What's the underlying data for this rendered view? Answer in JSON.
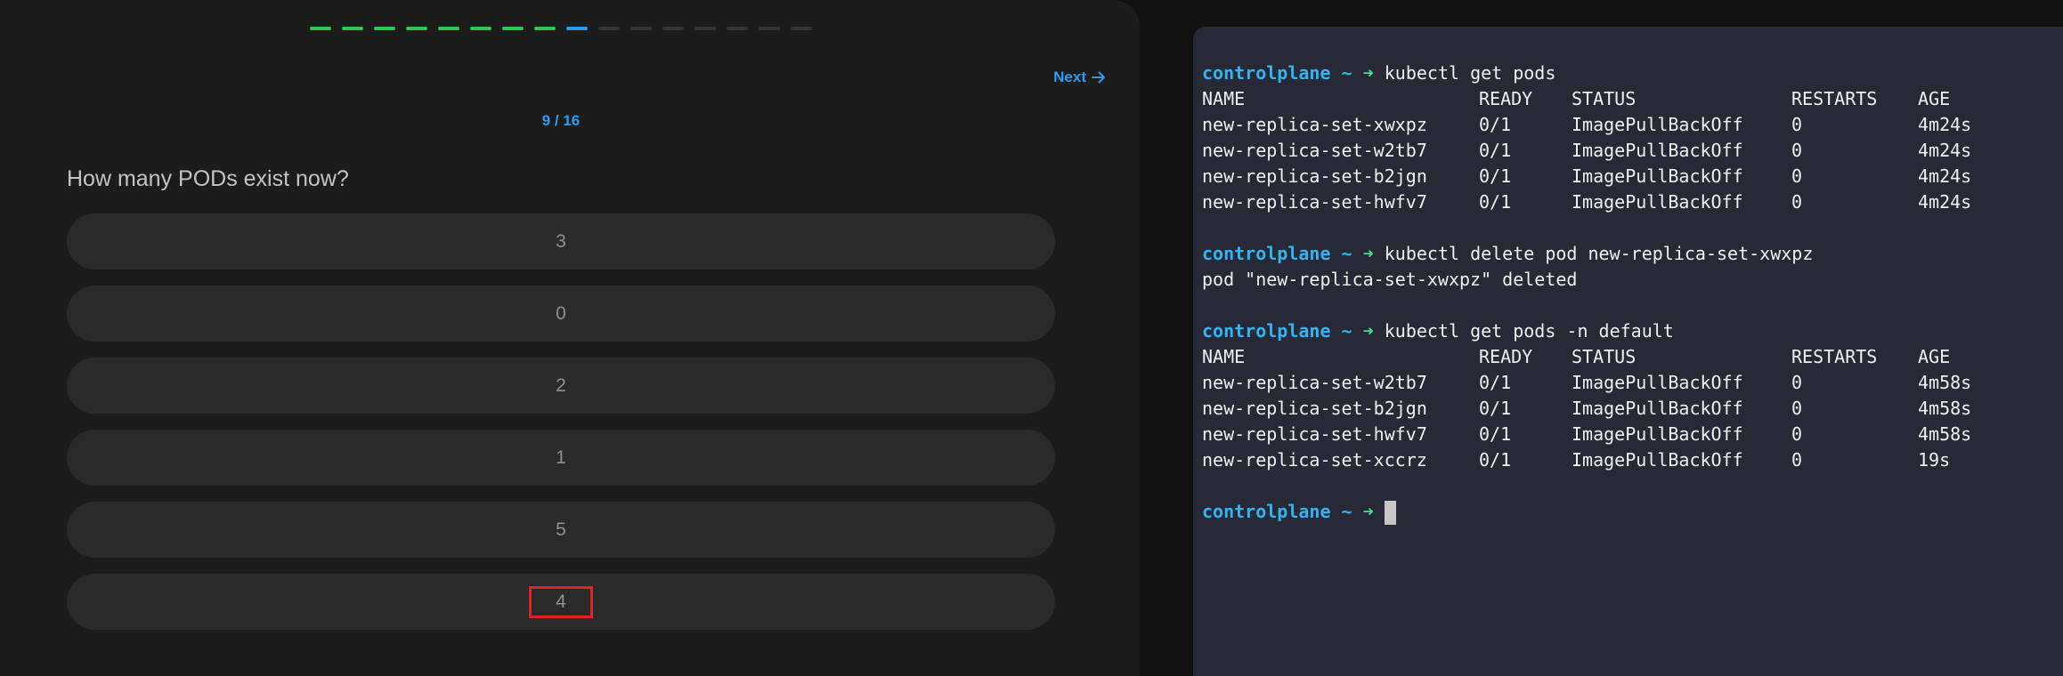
{
  "quiz": {
    "progress": {
      "total": 16,
      "completed": 8,
      "current": 9,
      "colors": {
        "completed": "#2ec84f",
        "current": "#2b9cf2",
        "pending": "#333335"
      }
    },
    "next_label": "Next",
    "counter": "9 / 16",
    "question": "How many PODs exist now?",
    "options": [
      "3",
      "0",
      "2",
      "1",
      "5",
      "4"
    ],
    "highlighted_option": "4"
  },
  "terminal": {
    "prompt_host": "controlplane",
    "prompt_tilde": "~",
    "prompt_arrow": "➜",
    "commands": [
      {
        "command": "kubectl get pods",
        "output_header": [
          "NAME",
          "READY",
          "STATUS",
          "RESTARTS",
          "AGE"
        ],
        "output_rows": [
          [
            "new-replica-set-xwxpz",
            "0/1",
            "ImagePullBackOff",
            "0",
            "4m24s"
          ],
          [
            "new-replica-set-w2tb7",
            "0/1",
            "ImagePullBackOff",
            "0",
            "4m24s"
          ],
          [
            "new-replica-set-b2jgn",
            "0/1",
            "ImagePullBackOff",
            "0",
            "4m24s"
          ],
          [
            "new-replica-set-hwfv7",
            "0/1",
            "ImagePullBackOff",
            "0",
            "4m24s"
          ]
        ]
      },
      {
        "command": "kubectl delete pod new-replica-set-xwxpz",
        "output_text": "pod \"new-replica-set-xwxpz\" deleted"
      },
      {
        "command": "kubectl get pods -n default",
        "output_header": [
          "NAME",
          "READY",
          "STATUS",
          "RESTARTS",
          "AGE"
        ],
        "output_rows": [
          [
            "new-replica-set-w2tb7",
            "0/1",
            "ImagePullBackOff",
            "0",
            "4m58s"
          ],
          [
            "new-replica-set-b2jgn",
            "0/1",
            "ImagePullBackOff",
            "0",
            "4m58s"
          ],
          [
            "new-replica-set-hwfv7",
            "0/1",
            "ImagePullBackOff",
            "0",
            "4m58s"
          ],
          [
            "new-replica-set-xccrz",
            "0/1",
            "ImagePullBackOff",
            "0",
            "19s"
          ]
        ]
      }
    ]
  }
}
